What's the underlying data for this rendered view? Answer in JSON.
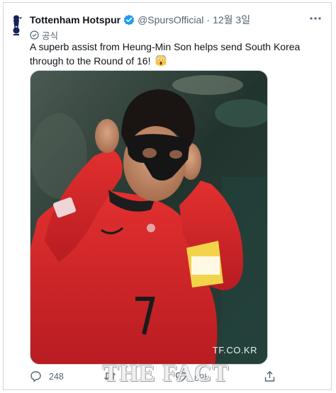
{
  "tweet": {
    "display_name": "Tottenham Hotspur",
    "handle": "@SpursOfficial",
    "separator": "·",
    "date": "12월 3일",
    "official_label": "공식",
    "text": "A superb assist from Heung-Min Son helps send South Korea through to the Round of 16!",
    "emoji": "face-screaming-in-fear",
    "media_credit": "TF.CO.KR"
  },
  "actions": {
    "reply_count": "248",
    "retweet_count": "",
    "like_count": "8만"
  },
  "watermark": "THE FACT",
  "icons": {
    "avatar": "spurs-cockerel-icon",
    "verified": "verified-badge-icon",
    "official": "official-badge-icon",
    "more": "more-icon",
    "reply": "reply-icon",
    "retweet": "retweet-icon",
    "like": "like-icon",
    "share": "share-icon"
  },
  "colors": {
    "verified_blue": "#1d9bf0",
    "text_primary": "#0f1419",
    "text_secondary": "#536471",
    "jersey_red": "#d8262a"
  }
}
